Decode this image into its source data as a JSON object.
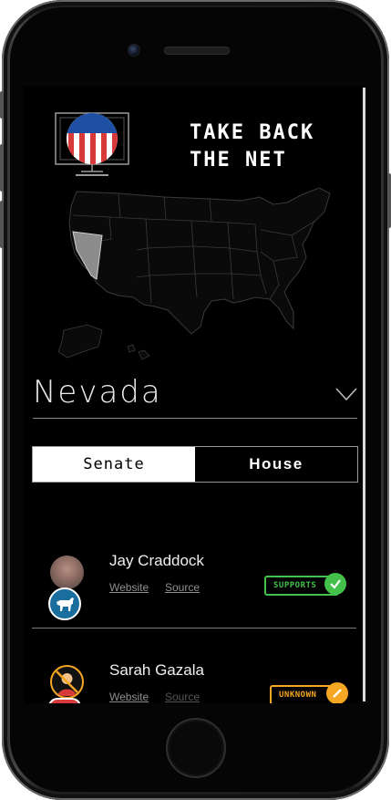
{
  "app": {
    "title": "TAKE BACK\nTHE NET",
    "selected_state": "Nevada"
  },
  "tabs": [
    {
      "label": "Senate",
      "active": true
    },
    {
      "label": "House",
      "active": false
    }
  ],
  "representatives": [
    {
      "name": "Jay Craddock",
      "party": "democrat",
      "website_label": "Website",
      "source_label": "Source",
      "status": "SUPPORTS",
      "status_color": "#43c14a"
    },
    {
      "name": "Sarah Gazala",
      "party": "republican",
      "website_label": "Website",
      "source_label": "Source",
      "status": "UNKNOWN",
      "status_color": "#f5a623"
    }
  ],
  "icons": {
    "logo": "monitor-flag-icon",
    "state_dropdown": "chevron-down-icon",
    "supports": "check-icon",
    "unknown": "pencil-icon",
    "democrat": "donkey-icon",
    "republican": "elephant-icon"
  },
  "colors": {
    "background": "#000000",
    "supports": "#43c14a",
    "unknown": "#f5a623",
    "selected_state_fill": "#8c8c8c",
    "democrat": "#1a6e9e",
    "flag_blue": "#1f4fa3",
    "flag_red": "#d83a3a"
  }
}
